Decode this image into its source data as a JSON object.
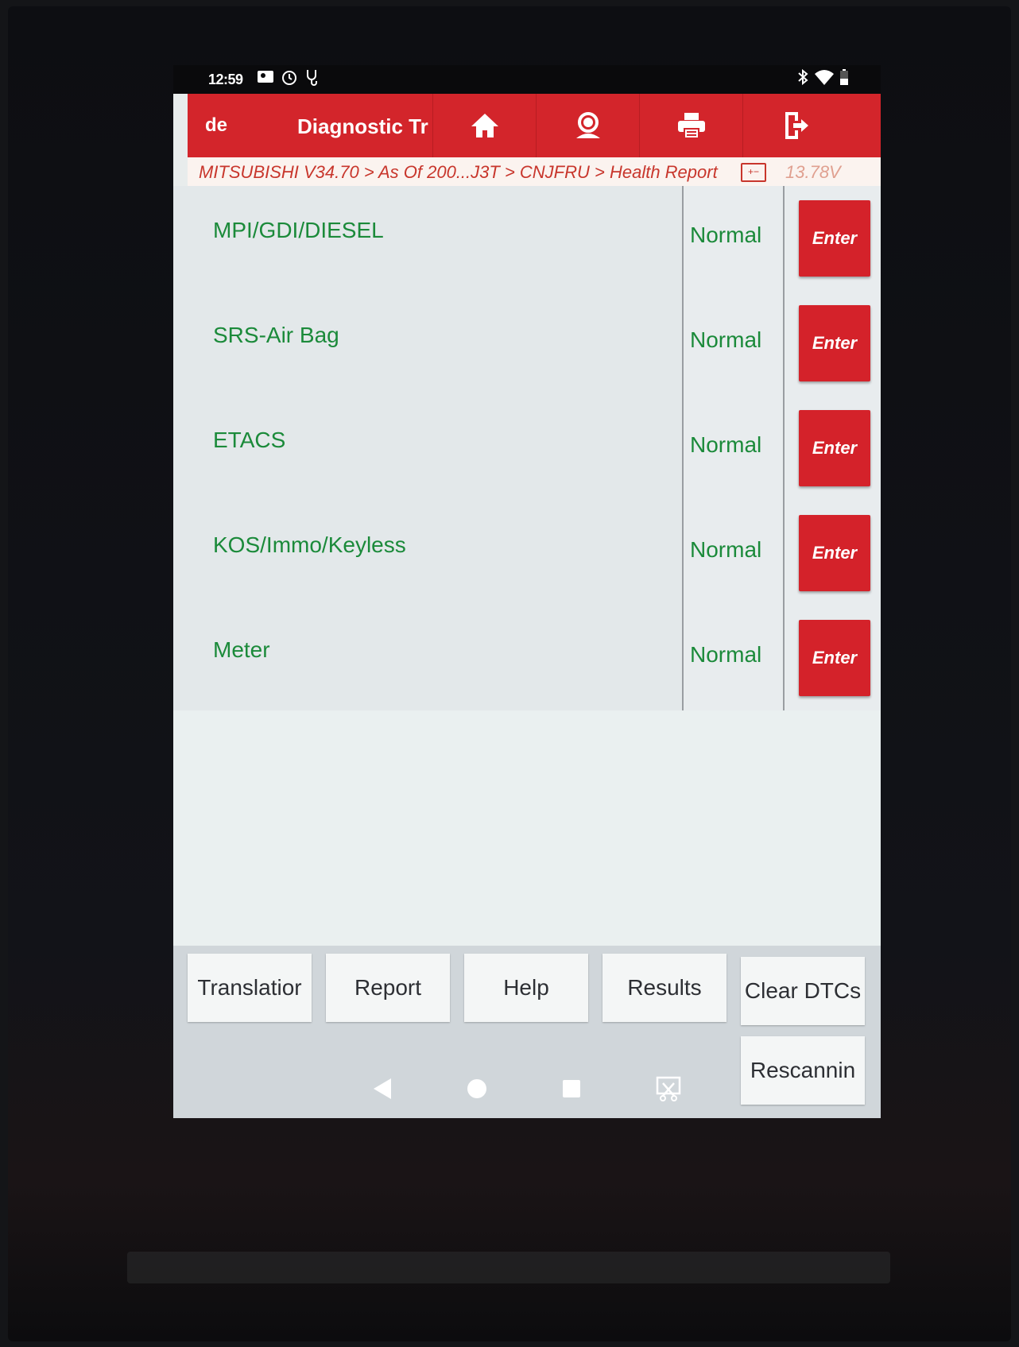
{
  "status_bar": {
    "time": "12:59",
    "left_icons": [
      "photo-icon",
      "timer-icon",
      "stethoscope-icon"
    ],
    "right_icons": [
      "bluetooth-icon",
      "wifi-icon",
      "battery-icon"
    ]
  },
  "header": {
    "left_text": "de",
    "title": "Diagnostic Tr",
    "buttons": [
      "home-icon",
      "support-icon",
      "print-icon",
      "exit-icon"
    ],
    "color": "#d3252b"
  },
  "breadcrumb": {
    "path": "MITSUBISHI V34.70 > As Of 200...J3T > CNJFRU > Health Report",
    "battery_symbol": "+−",
    "voltage": "13.78V"
  },
  "systems": [
    {
      "name": "MPI/GDI/DIESEL",
      "status": "Normal",
      "action": "Enter"
    },
    {
      "name": "SRS-Air Bag",
      "status": "Normal",
      "action": "Enter"
    },
    {
      "name": "ETACS",
      "status": "Normal",
      "action": "Enter"
    },
    {
      "name": "KOS/Immo/Keyless",
      "status": "Normal",
      "action": "Enter"
    },
    {
      "name": "Meter",
      "status": "Normal",
      "action": "Enter"
    }
  ],
  "bottom_buttons": {
    "translation": "Translatior",
    "report": "Report",
    "help": "Help",
    "results": "Results",
    "clear_dtcs": "Clear DTCs",
    "rescanning": "Rescannin"
  },
  "nav_bar": [
    "back-icon",
    "home-circle-icon",
    "recents-icon",
    "screenshot-icon"
  ],
  "colors": {
    "status_green": "#1b8a3a",
    "enter_red": "#d4222a",
    "breadcrumb_text": "#c8362c"
  }
}
